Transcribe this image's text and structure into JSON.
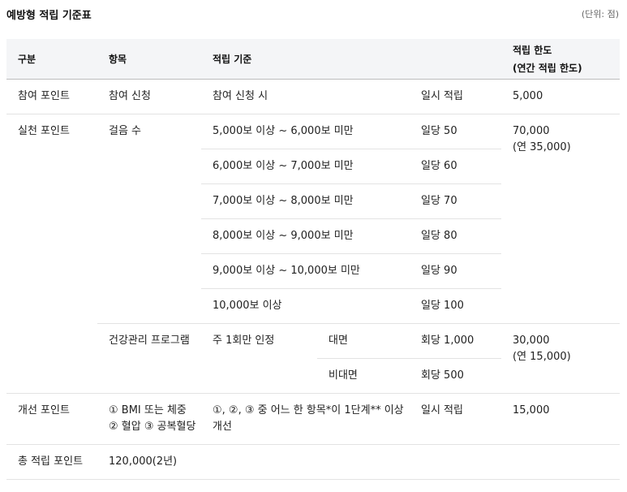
{
  "title": "예방형 적립 기준표",
  "unit": "(단위: 점)",
  "headers": {
    "category": "구분",
    "item": "항목",
    "criteria": "적립 기준",
    "limit_line1": "적립 한도",
    "limit_line2": "(연간 적립 한도)"
  },
  "participation": {
    "category": "참여 포인트",
    "item": "참여 신청",
    "criteria": "참여 신청 시",
    "amount": "일시 적립",
    "limit": "5,000"
  },
  "practice": {
    "category": "실천 포인트",
    "steps": {
      "item": "걸음 수",
      "limit_line1": "70,000",
      "limit_line2": "(연 35,000)",
      "rows": [
        {
          "criteria": "5,000보 이상 ~ 6,000보 미만",
          "amount": "일당 50"
        },
        {
          "criteria": "6,000보 이상 ~ 7,000보 미만",
          "amount": "일당 60"
        },
        {
          "criteria": "7,000보 이상 ~ 8,000보 미만",
          "amount": "일당 70"
        },
        {
          "criteria": "8,000보 이상 ~ 9,000보 미만",
          "amount": "일당 80"
        },
        {
          "criteria": "9,000보 이상 ~ 10,000보 미만",
          "amount": "일당 90"
        },
        {
          "criteria": "10,000보 이상",
          "amount": "일당 100"
        }
      ]
    },
    "program": {
      "item": "건강관리 프로그램",
      "criteria": "주 1회만 인정",
      "limit_line1": "30,000",
      "limit_line2": "(연 15,000)",
      "rows": [
        {
          "mode": "대면",
          "amount": "회당 1,000"
        },
        {
          "mode": "비대면",
          "amount": "회당 500"
        }
      ]
    }
  },
  "improvement": {
    "category": "개선 포인트",
    "item": "① BMI 또는 체중 ② 혈압 ③ 공복혈당",
    "criteria": "①, ②, ③ 중 어느 한 항목*이 1단계** 이상 개선",
    "amount": "일시 적립",
    "limit": "15,000"
  },
  "total": {
    "category": "총 적립 포인트",
    "value": "120,000(2년)"
  }
}
